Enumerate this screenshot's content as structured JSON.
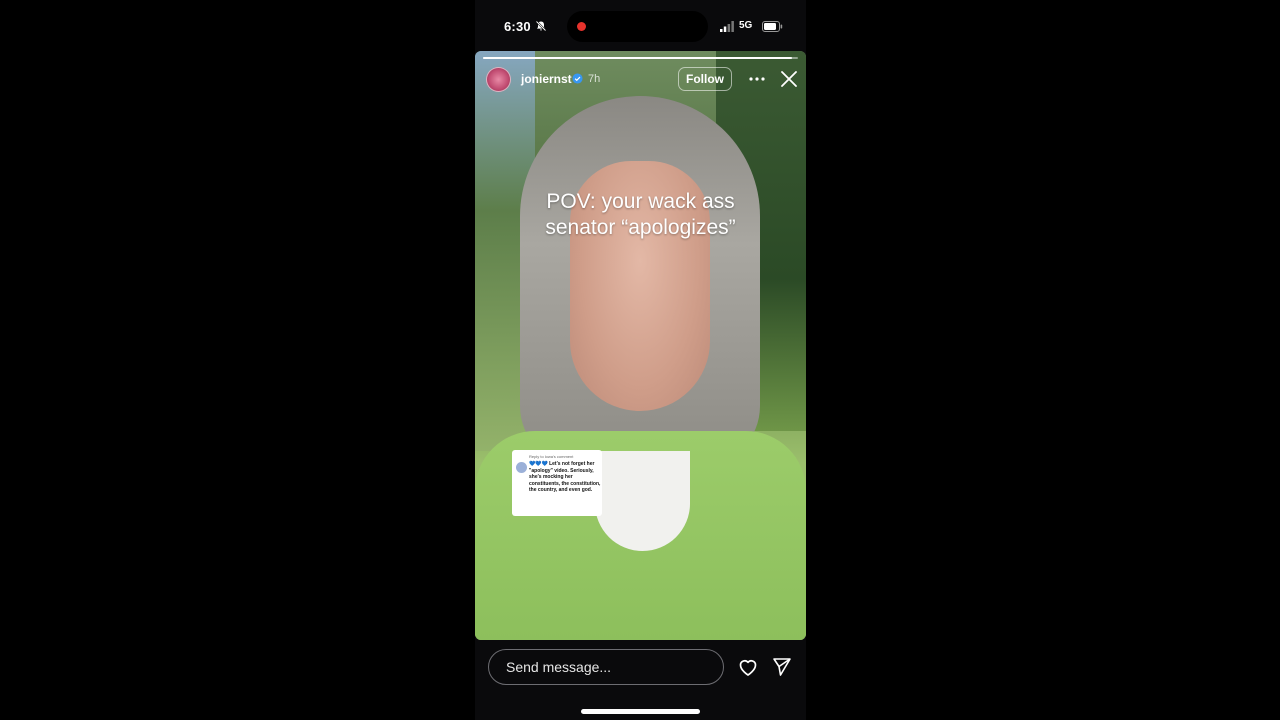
{
  "status_bar": {
    "time": "6:30",
    "network": "5G",
    "recording": true,
    "icons": [
      "bell-slash-icon",
      "signal-icon",
      "battery-icon"
    ]
  },
  "story": {
    "progress": 0.98,
    "username": "jonierns​t",
    "verified": true,
    "time_ago": "7h",
    "follow_label": "Follow",
    "caption_line1": "POV: your wack ass",
    "caption_line2": "senator “apologizes”",
    "reply_card": {
      "header": "Reply to lowa's comment",
      "body": "💙💙💙 Let's not forget her \"apology\" video. Seriously, she's mocking her constituents, the constitution, the country, and even god."
    }
  },
  "bottom_bar": {
    "message_placeholder": "Send message...",
    "icons": [
      "heart-icon",
      "send-icon"
    ]
  }
}
